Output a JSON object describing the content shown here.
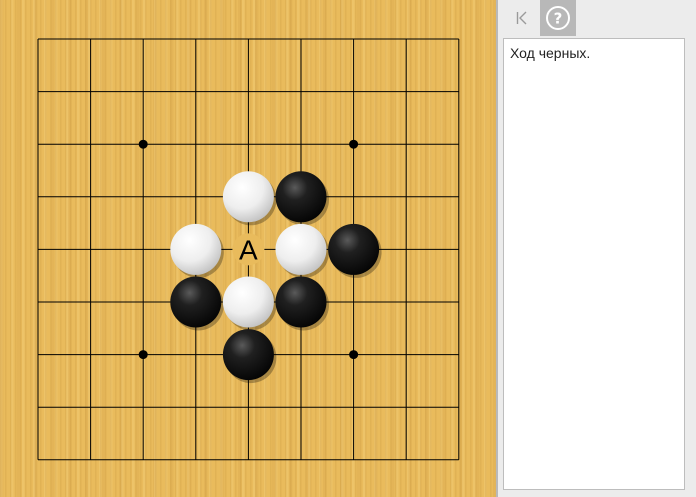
{
  "board": {
    "size": 9,
    "star_points": [
      [
        2,
        2
      ],
      [
        6,
        2
      ],
      [
        2,
        6
      ],
      [
        6,
        6
      ]
    ],
    "stones": [
      {
        "color": "white",
        "col": 4,
        "row": 3
      },
      {
        "color": "black",
        "col": 5,
        "row": 3
      },
      {
        "color": "white",
        "col": 3,
        "row": 4
      },
      {
        "color": "white",
        "col": 5,
        "row": 4
      },
      {
        "color": "black",
        "col": 6,
        "row": 4
      },
      {
        "color": "black",
        "col": 3,
        "row": 5
      },
      {
        "color": "white",
        "col": 4,
        "row": 5
      },
      {
        "color": "black",
        "col": 5,
        "row": 5
      },
      {
        "color": "black",
        "col": 4,
        "row": 6
      }
    ],
    "labels": [
      {
        "text": "A",
        "col": 4,
        "row": 4
      }
    ]
  },
  "toolbar": {
    "back_icon": "back-to-start-icon",
    "help_icon": "question-circle-icon"
  },
  "comment": {
    "text": "Ход черных."
  }
}
